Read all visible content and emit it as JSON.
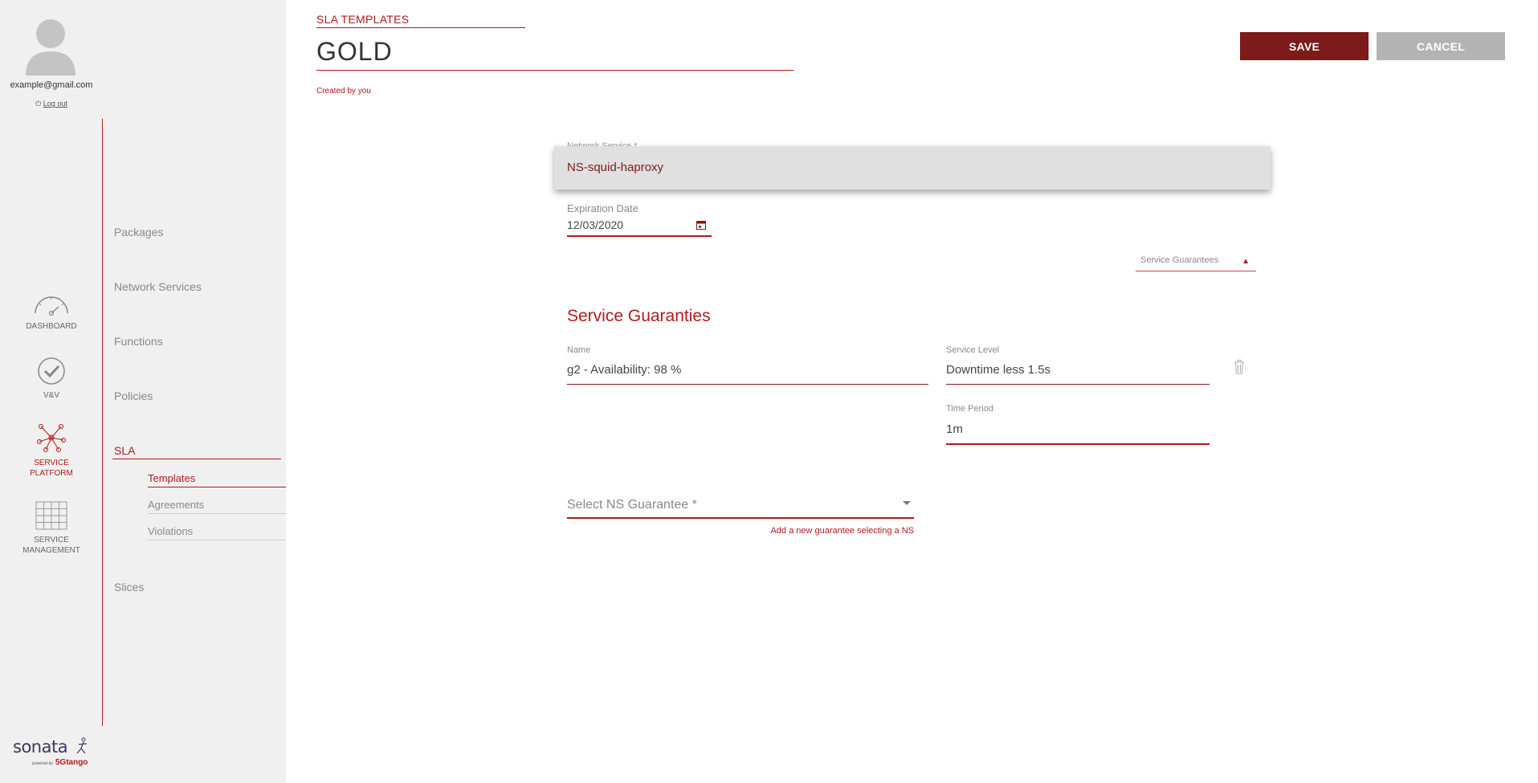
{
  "user": {
    "email": "example@gmail.com",
    "logout_label": "Log out"
  },
  "nav_icons": [
    {
      "name": "dashboard",
      "label": "DASHBOARD",
      "icon": "speedometer-icon"
    },
    {
      "name": "vv",
      "label": "V&V",
      "icon": "check-circle-icon"
    },
    {
      "name": "service-platform",
      "label_lines": [
        "SERVICE",
        "PLATFORM"
      ],
      "icon": "network-hub-icon",
      "active": true
    },
    {
      "name": "service-management",
      "label_lines": [
        "SERVICE",
        "MANAGEMENT"
      ],
      "icon": "grid-icon"
    }
  ],
  "menu": {
    "items": [
      "Packages",
      "Network Services",
      "Functions",
      "Policies",
      "SLA",
      "Slices"
    ],
    "active": "SLA",
    "sla_subitems": [
      "Templates",
      "Agreements",
      "Violations"
    ],
    "active_subitem": "Templates"
  },
  "brand": {
    "name": "sonata",
    "powered_by": "powered by",
    "partner": "5Gtango"
  },
  "header": {
    "breadcrumb": "SLA TEMPLATES",
    "title": "GOLD",
    "created_by": "Created by you",
    "save_label": "SAVE",
    "cancel_label": "CANCEL"
  },
  "form": {
    "network_service_label": "Network Service *",
    "network_service_option": "NS-squid-haproxy",
    "expiration_label": "Expiration Date",
    "expiration_value": "12/03/2020",
    "sg_select_label": "Service Guarantees",
    "section_title": "Service Guaranties",
    "guarantee": {
      "name_label": "Name",
      "name_value": "g2 - Availability: 98 %",
      "level_label": "Service Level",
      "level_value": "Downtime less 1.5s",
      "period_label": "Time Period",
      "period_value": "1m"
    },
    "ns_guarantee_placeholder": "Select NS Guarantee *",
    "ns_guarantee_hint": "Add a new guarantee selecting a NS"
  },
  "colors": {
    "accent": "#b11a1a",
    "save_bg": "#7d1a1a",
    "cancel_bg": "#b3b3b3",
    "sidebar_bg": "#f0f0f0"
  }
}
